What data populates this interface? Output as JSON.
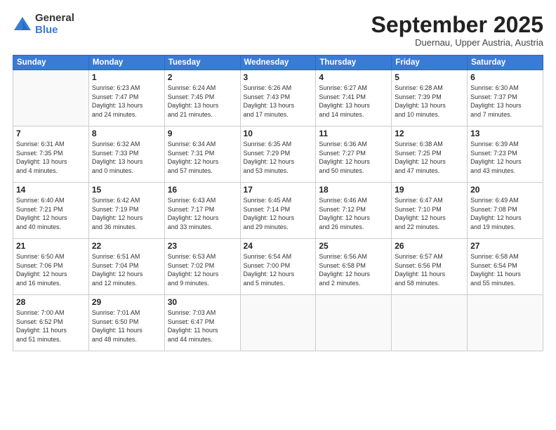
{
  "logo": {
    "general": "General",
    "blue": "Blue"
  },
  "title": "September 2025",
  "subtitle": "Duernau, Upper Austria, Austria",
  "weekdays": [
    "Sunday",
    "Monday",
    "Tuesday",
    "Wednesday",
    "Thursday",
    "Friday",
    "Saturday"
  ],
  "weeks": [
    [
      {
        "day": "",
        "info": ""
      },
      {
        "day": "1",
        "info": "Sunrise: 6:23 AM\nSunset: 7:47 PM\nDaylight: 13 hours\nand 24 minutes."
      },
      {
        "day": "2",
        "info": "Sunrise: 6:24 AM\nSunset: 7:45 PM\nDaylight: 13 hours\nand 21 minutes."
      },
      {
        "day": "3",
        "info": "Sunrise: 6:26 AM\nSunset: 7:43 PM\nDaylight: 13 hours\nand 17 minutes."
      },
      {
        "day": "4",
        "info": "Sunrise: 6:27 AM\nSunset: 7:41 PM\nDaylight: 13 hours\nand 14 minutes."
      },
      {
        "day": "5",
        "info": "Sunrise: 6:28 AM\nSunset: 7:39 PM\nDaylight: 13 hours\nand 10 minutes."
      },
      {
        "day": "6",
        "info": "Sunrise: 6:30 AM\nSunset: 7:37 PM\nDaylight: 13 hours\nand 7 minutes."
      }
    ],
    [
      {
        "day": "7",
        "info": "Sunrise: 6:31 AM\nSunset: 7:35 PM\nDaylight: 13 hours\nand 4 minutes."
      },
      {
        "day": "8",
        "info": "Sunrise: 6:32 AM\nSunset: 7:33 PM\nDaylight: 13 hours\nand 0 minutes."
      },
      {
        "day": "9",
        "info": "Sunrise: 6:34 AM\nSunset: 7:31 PM\nDaylight: 12 hours\nand 57 minutes."
      },
      {
        "day": "10",
        "info": "Sunrise: 6:35 AM\nSunset: 7:29 PM\nDaylight: 12 hours\nand 53 minutes."
      },
      {
        "day": "11",
        "info": "Sunrise: 6:36 AM\nSunset: 7:27 PM\nDaylight: 12 hours\nand 50 minutes."
      },
      {
        "day": "12",
        "info": "Sunrise: 6:38 AM\nSunset: 7:25 PM\nDaylight: 12 hours\nand 47 minutes."
      },
      {
        "day": "13",
        "info": "Sunrise: 6:39 AM\nSunset: 7:23 PM\nDaylight: 12 hours\nand 43 minutes."
      }
    ],
    [
      {
        "day": "14",
        "info": "Sunrise: 6:40 AM\nSunset: 7:21 PM\nDaylight: 12 hours\nand 40 minutes."
      },
      {
        "day": "15",
        "info": "Sunrise: 6:42 AM\nSunset: 7:19 PM\nDaylight: 12 hours\nand 36 minutes."
      },
      {
        "day": "16",
        "info": "Sunrise: 6:43 AM\nSunset: 7:17 PM\nDaylight: 12 hours\nand 33 minutes."
      },
      {
        "day": "17",
        "info": "Sunrise: 6:45 AM\nSunset: 7:14 PM\nDaylight: 12 hours\nand 29 minutes."
      },
      {
        "day": "18",
        "info": "Sunrise: 6:46 AM\nSunset: 7:12 PM\nDaylight: 12 hours\nand 26 minutes."
      },
      {
        "day": "19",
        "info": "Sunrise: 6:47 AM\nSunset: 7:10 PM\nDaylight: 12 hours\nand 22 minutes."
      },
      {
        "day": "20",
        "info": "Sunrise: 6:49 AM\nSunset: 7:08 PM\nDaylight: 12 hours\nand 19 minutes."
      }
    ],
    [
      {
        "day": "21",
        "info": "Sunrise: 6:50 AM\nSunset: 7:06 PM\nDaylight: 12 hours\nand 16 minutes."
      },
      {
        "day": "22",
        "info": "Sunrise: 6:51 AM\nSunset: 7:04 PM\nDaylight: 12 hours\nand 12 minutes."
      },
      {
        "day": "23",
        "info": "Sunrise: 6:53 AM\nSunset: 7:02 PM\nDaylight: 12 hours\nand 9 minutes."
      },
      {
        "day": "24",
        "info": "Sunrise: 6:54 AM\nSunset: 7:00 PM\nDaylight: 12 hours\nand 5 minutes."
      },
      {
        "day": "25",
        "info": "Sunrise: 6:56 AM\nSunset: 6:58 PM\nDaylight: 12 hours\nand 2 minutes."
      },
      {
        "day": "26",
        "info": "Sunrise: 6:57 AM\nSunset: 6:56 PM\nDaylight: 11 hours\nand 58 minutes."
      },
      {
        "day": "27",
        "info": "Sunrise: 6:58 AM\nSunset: 6:54 PM\nDaylight: 11 hours\nand 55 minutes."
      }
    ],
    [
      {
        "day": "28",
        "info": "Sunrise: 7:00 AM\nSunset: 6:52 PM\nDaylight: 11 hours\nand 51 minutes."
      },
      {
        "day": "29",
        "info": "Sunrise: 7:01 AM\nSunset: 6:50 PM\nDaylight: 11 hours\nand 48 minutes."
      },
      {
        "day": "30",
        "info": "Sunrise: 7:03 AM\nSunset: 6:47 PM\nDaylight: 11 hours\nand 44 minutes."
      },
      {
        "day": "",
        "info": ""
      },
      {
        "day": "",
        "info": ""
      },
      {
        "day": "",
        "info": ""
      },
      {
        "day": "",
        "info": ""
      }
    ]
  ]
}
